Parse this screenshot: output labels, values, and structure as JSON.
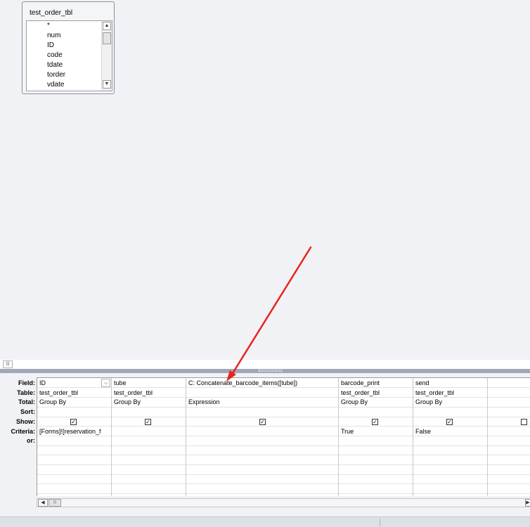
{
  "design": {
    "table_name": "test_order_tbl",
    "fields": [
      "*",
      "num",
      "ID",
      "code",
      "tdate",
      "torder",
      "vdate"
    ]
  },
  "grid": {
    "row_labels": {
      "field": "Field:",
      "table": "Table:",
      "total": "Total:",
      "sort": "Sort:",
      "show": "Show:",
      "criteria": "Criteria:",
      "or": "or:"
    },
    "columns": [
      {
        "field": "ID",
        "table": "test_order_tbl",
        "total": "Group By",
        "show": true,
        "criteria": "[Forms]![reservation_f",
        "or": ""
      },
      {
        "field": "tube",
        "table": "test_order_tbl",
        "total": "Group By",
        "show": true,
        "criteria": "",
        "or": ""
      },
      {
        "field": "C: Concatenate_barcode_items([tube])",
        "table": "",
        "total": "Expression",
        "show": true,
        "criteria": "",
        "or": ""
      },
      {
        "field": "barcode_print",
        "table": "test_order_tbl",
        "total": "Group By",
        "show": true,
        "criteria": "True",
        "or": ""
      },
      {
        "field": "send",
        "table": "test_order_tbl",
        "total": "Group By",
        "show": true,
        "criteria": "False",
        "or": ""
      },
      {
        "field": "",
        "table": "",
        "total": "",
        "show": false,
        "criteria": "",
        "or": ""
      }
    ]
  },
  "annotation": {
    "arrow_color": "#e8231f"
  },
  "icons": [
    "scroll-up-icon",
    "scroll-down-icon",
    "scroll-left-icon",
    "scroll-right-icon",
    "dropdown-arrow-icon",
    "checkbox-icon"
  ]
}
